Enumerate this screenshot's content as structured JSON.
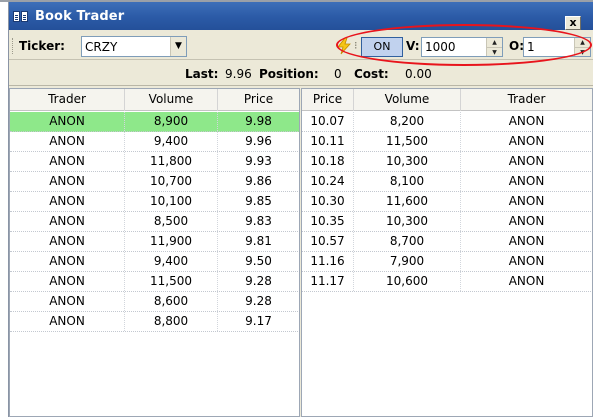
{
  "window": {
    "title": "Book Trader",
    "close_label": "x"
  },
  "toolbar": {
    "ticker_label": "Ticker:",
    "ticker_value": "CRZY",
    "on_label": "ON",
    "v_label": "V:",
    "v_value": "1000",
    "o_label": "O:",
    "o_value": "1"
  },
  "status": {
    "last_label": "Last:",
    "last_value": "9.96",
    "position_label": "Position:",
    "position_value": "0",
    "cost_label": "Cost:",
    "cost_value": "0.00"
  },
  "bids": {
    "headers": [
      "Trader",
      "Volume",
      "Price"
    ],
    "rows": [
      [
        "ANON",
        "8,900",
        "9.98"
      ],
      [
        "ANON",
        "9,400",
        "9.96"
      ],
      [
        "ANON",
        "11,800",
        "9.93"
      ],
      [
        "ANON",
        "10,700",
        "9.86"
      ],
      [
        "ANON",
        "10,100",
        "9.85"
      ],
      [
        "ANON",
        "8,500",
        "9.83"
      ],
      [
        "ANON",
        "11,900",
        "9.81"
      ],
      [
        "ANON",
        "9,400",
        "9.50"
      ],
      [
        "ANON",
        "11,500",
        "9.28"
      ],
      [
        "ANON",
        "8,600",
        "9.28"
      ],
      [
        "ANON",
        "8,800",
        "9.17"
      ]
    ]
  },
  "asks": {
    "headers": [
      "Price",
      "Volume",
      "Trader"
    ],
    "rows": [
      [
        "10.07",
        "8,200",
        "ANON"
      ],
      [
        "10.11",
        "11,500",
        "ANON"
      ],
      [
        "10.18",
        "10,300",
        "ANON"
      ],
      [
        "10.24",
        "8,100",
        "ANON"
      ],
      [
        "10.30",
        "11,600",
        "ANON"
      ],
      [
        "10.35",
        "10,300",
        "ANON"
      ],
      [
        "10.57",
        "8,700",
        "ANON"
      ],
      [
        "11.16",
        "7,900",
        "ANON"
      ],
      [
        "11.17",
        "10,600",
        "ANON"
      ]
    ]
  },
  "colors": {
    "title_bar": "#2b5aa6",
    "highlight_row": "#8ee88a",
    "annotation_ellipse": "#e8141c"
  }
}
